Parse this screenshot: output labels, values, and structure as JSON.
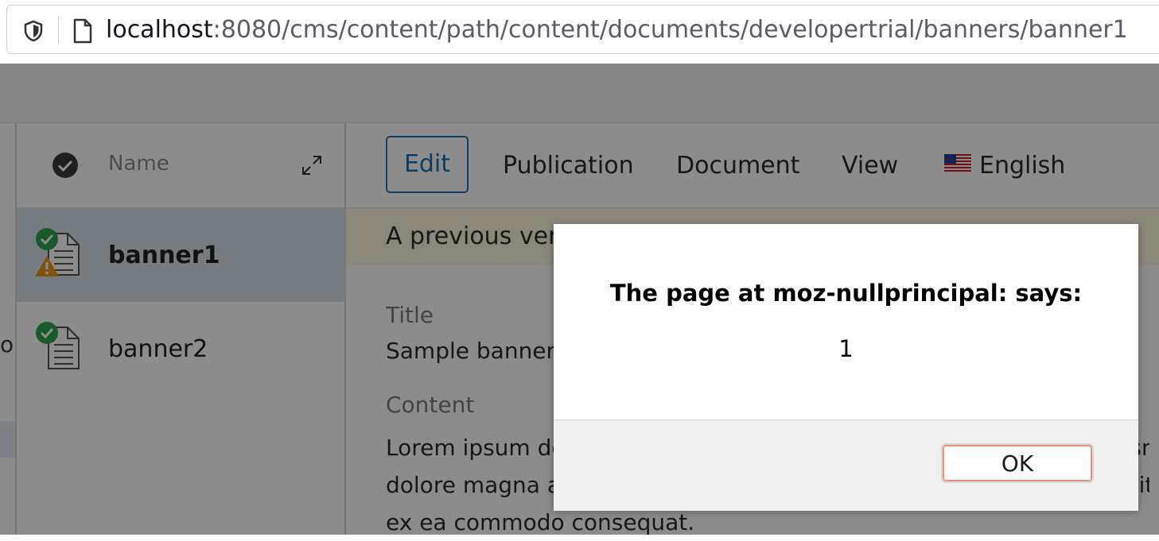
{
  "browser": {
    "url_host": "localhost",
    "url_rest": ":8080/cms/content/path/content/documents/developertrial/banners/banner1"
  },
  "sidebar": {
    "fragment": "o"
  },
  "list": {
    "header_name": "Name",
    "items": [
      {
        "label": "banner1",
        "status": "published-with-warning"
      },
      {
        "label": "banner2",
        "status": "published"
      }
    ]
  },
  "toolbar": {
    "tabs": {
      "edit": "Edit",
      "publication": "Publication",
      "document": "Document",
      "view": "View",
      "language": "English"
    }
  },
  "notice": {
    "text": "A previous version"
  },
  "document": {
    "title_label": "Title",
    "title_value": "Sample banner",
    "content_label": "Content",
    "content_lines": [
      "Lorem ipsum dolor sit amet, consectetur adipiscing elit, sed do eiusmod tempor incididunt ut labore et",
      "dolore magna aliqua. Ut enim ad minim veniam, quis nostrud exercitation ullamco laboris nisi ut aliquip",
      "ex ea commodo consequat."
    ]
  },
  "dialog": {
    "title": "The page at moz-nullprincipal: says:",
    "message": "1",
    "ok_label": "OK"
  },
  "colors": {
    "accent": "#1e6fb6",
    "success": "#2ea44f",
    "warning": "#e8961e",
    "ok_border": "#e9917a"
  },
  "icons": [
    "shield-icon",
    "page-icon",
    "check-circle-icon",
    "expand-icon",
    "document-icon",
    "warning-icon",
    "us-flag-icon"
  ]
}
